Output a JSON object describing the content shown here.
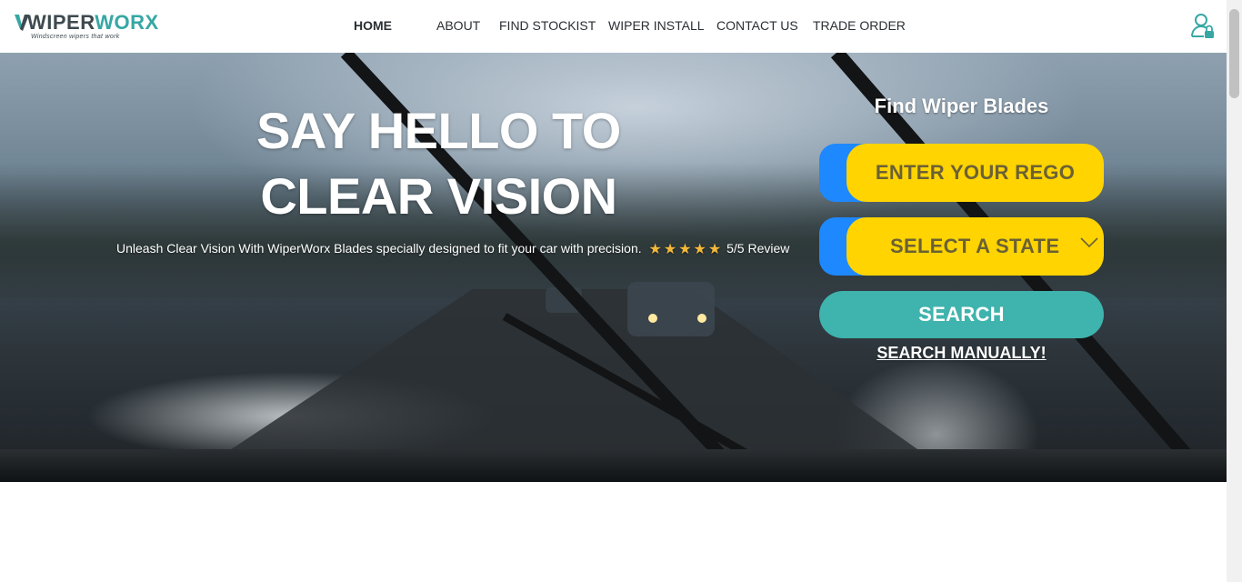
{
  "brand": {
    "name_part1": "W",
    "name_part2": "IPER",
    "name_part3": "WORX",
    "tagline": "Windscreen wipers that work"
  },
  "nav": {
    "items": [
      {
        "label": "HOME",
        "active": true
      },
      {
        "label": "ABOUT",
        "active": false
      },
      {
        "label": "FIND STOCKIST",
        "active": false
      },
      {
        "label": "WIPER INSTALL",
        "active": false
      },
      {
        "label": "CONTACT US",
        "active": false
      },
      {
        "label": "TRADE ORDER",
        "active": false
      }
    ]
  },
  "user_icon": "user-lock-icon",
  "hero": {
    "title_line1": "SAY HELLO TO",
    "title_line2": "CLEAR VISION",
    "subtitle": "Unleash Clear Vision With WiperWorx Blades specially designed to fit your car with precision.",
    "rating_stars": 5,
    "rating_text": "5/5 Review"
  },
  "search_panel": {
    "title": "Find Wiper Blades",
    "rego_placeholder": "ENTER YOUR REGO",
    "state_selected": "SELECT A STATE",
    "search_label": "SEARCH",
    "manual_link": "SEARCH MANUALLY!"
  },
  "colors": {
    "accent_teal": "#3fb3ad",
    "field_yellow": "#ffd400",
    "field_blue": "#1e88ff",
    "star": "#f4b93a"
  }
}
